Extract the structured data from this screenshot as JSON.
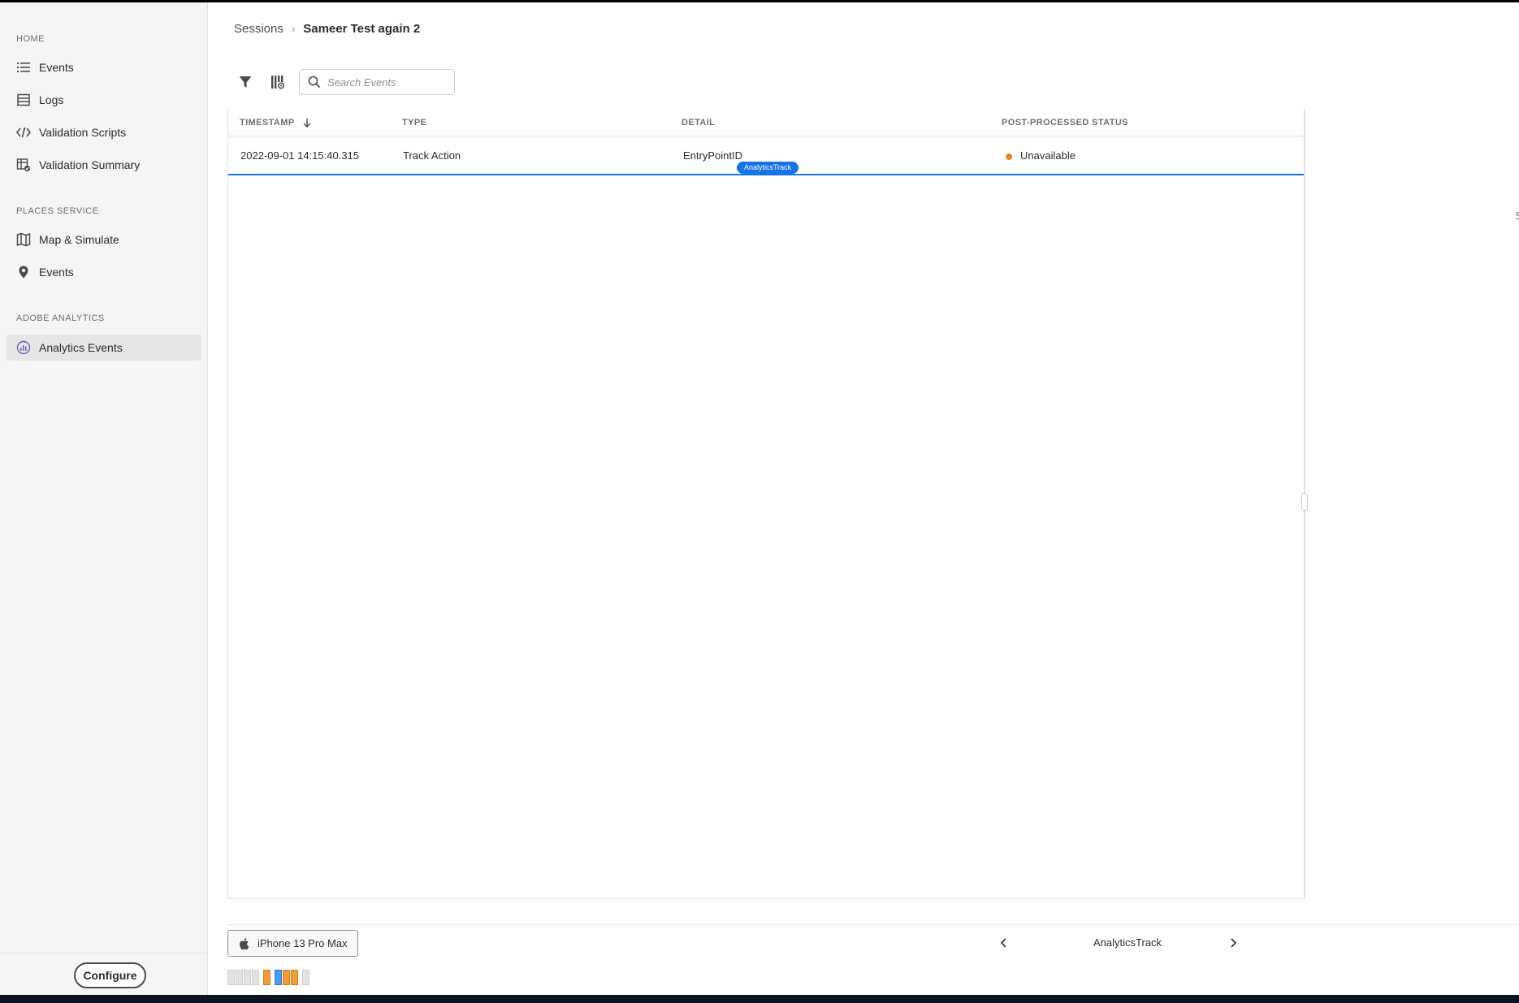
{
  "sidebar": {
    "sections": [
      {
        "heading": "HOME",
        "items": [
          {
            "label": "Events",
            "icon": "list-icon"
          },
          {
            "label": "Logs",
            "icon": "logs-icon"
          },
          {
            "label": "Validation Scripts",
            "icon": "code-icon"
          },
          {
            "label": "Validation Summary",
            "icon": "summary-icon"
          }
        ]
      },
      {
        "heading": "PLACES SERVICE",
        "items": [
          {
            "label": "Map & Simulate",
            "icon": "map-icon"
          },
          {
            "label": "Events",
            "icon": "pin-icon"
          }
        ]
      },
      {
        "heading": "ADOBE ANALYTICS",
        "items": [
          {
            "label": "Analytics Events",
            "icon": "analytics-icon",
            "active": true
          }
        ]
      }
    ],
    "configure_label": "Configure"
  },
  "breadcrumb": {
    "parent": "Sessions",
    "current": "Sameer Test again 2"
  },
  "search": {
    "placeholder": "Search Events",
    "value": ""
  },
  "table": {
    "columns": [
      "TIMESTAMP",
      "TYPE",
      "DETAIL",
      "POST-PROCESSED STATUS"
    ],
    "sort_column": "TIMESTAMP",
    "sort_direction": "descending",
    "rows": [
      {
        "timestamp": "2022-09-01 14:15:40.315",
        "type": "Track Action",
        "detail": "EntryPointID",
        "status": "Unavailable",
        "badge": "AnalyticsTrack"
      }
    ]
  },
  "right_panel": {
    "text": "S"
  },
  "footer": {
    "device": "iPhone 13 Pro Max",
    "pager_label": "AnalyticsTrack"
  },
  "colors": {
    "accent": "#1473e6",
    "status_unavailable": "#e68619",
    "timeline_orange": "#f29c3a",
    "timeline_blue": "#4b9cf5"
  },
  "timeline": [
    "grey",
    "grey",
    "grey",
    "grey",
    "gap",
    "orange",
    "gap",
    "blue",
    "orange",
    "orange",
    "gap",
    "grey"
  ]
}
